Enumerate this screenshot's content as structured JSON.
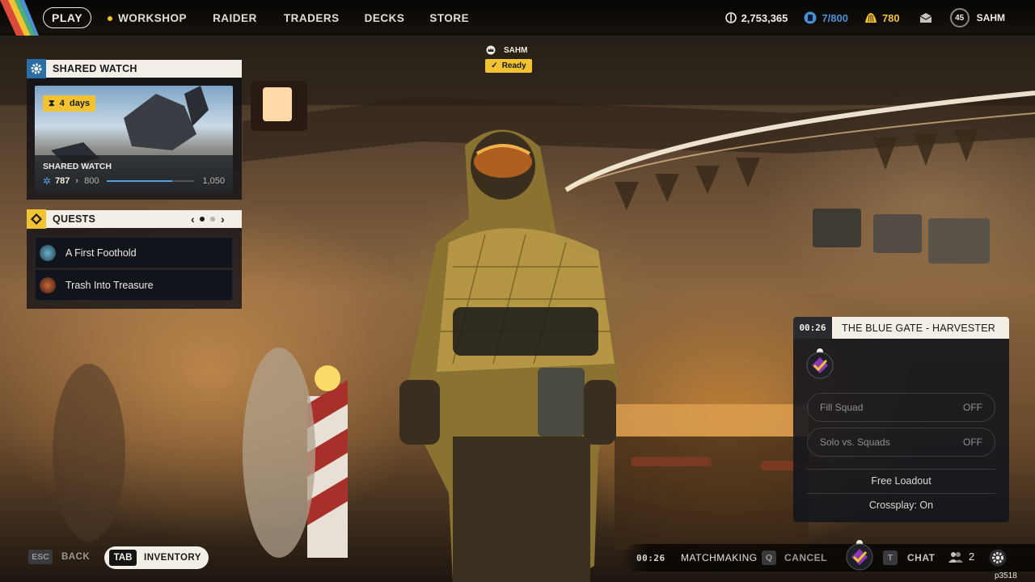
{
  "nav": {
    "play": "PLAY",
    "workshop": "WORKSHOP",
    "raider": "RAIDER",
    "traders": "TRADERS",
    "decks": "DECKS",
    "store": "STORE"
  },
  "currencies": {
    "coins": "2,753,365",
    "capacity": "7/800",
    "premium": "780"
  },
  "profile": {
    "level": "45",
    "name": "SAHM"
  },
  "party_tag": {
    "name": "SAHM",
    "status": "Ready"
  },
  "shared_watch": {
    "header": "SHARED WATCH",
    "timer": "4",
    "timer_unit": "days",
    "card_title": "SHARED WATCH",
    "current": "787",
    "next": "800",
    "max": "1,050"
  },
  "quests": {
    "header": "QUESTS",
    "page_index": 0,
    "page_count": 2,
    "items": [
      {
        "title": "A First Foothold"
      },
      {
        "title": "Trash Into Treasure"
      }
    ]
  },
  "matchmaking_card": {
    "timer": "00:26",
    "map": "THE BLUE GATE - HARVESTER",
    "fill_squad_label": "Fill Squad",
    "fill_squad_value": "OFF",
    "solo_label": "Solo vs. Squads",
    "solo_value": "OFF",
    "loadout": "Free Loadout",
    "crossplay": "Crossplay: On"
  },
  "bottom": {
    "esc_key": "ESC",
    "back": "BACK",
    "tab_key": "TAB",
    "inventory": "INVENTORY",
    "mm_timer": "00:26",
    "matchmaking": "MATCHMAKING",
    "cancel_key": "Q",
    "cancel": "CANCEL",
    "chat_key": "T",
    "chat": "CHAT",
    "party_count": "2"
  },
  "build_id": "p3518",
  "colors": {
    "accent_yellow": "#f1c232",
    "panel_light": "#f3efe6",
    "panel_dark": "#12141c",
    "capacity_blue": "#4a8fd8"
  }
}
